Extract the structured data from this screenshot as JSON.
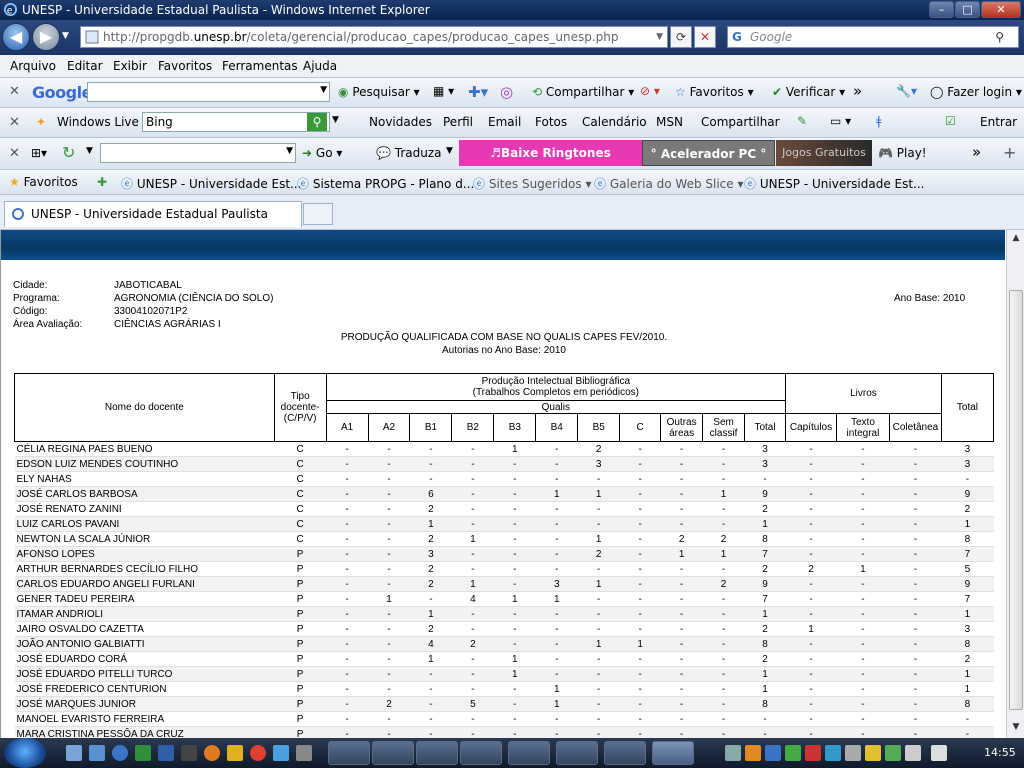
{
  "window": {
    "title": "UNESP - Universidade Estadual Paulista - Windows Internet Explorer"
  },
  "address": {
    "prefix": "http://propgdb.",
    "domain": "unesp.br",
    "suffix": "/coleta/gerencial/producao_capes/producao_capes_unesp.php",
    "search_placeholder": "Google"
  },
  "menu": [
    "Arquivo",
    "Editar",
    "Exibir",
    "Favoritos",
    "Ferramentas",
    "Ajuda"
  ],
  "google_bar": {
    "logo": "Google",
    "pesquisar": "Pesquisar",
    "compartilhar": "Compartilhar",
    "favoritos": "Favoritos",
    "verificar": "Verificar",
    "more": "»",
    "login": "Fazer login"
  },
  "live_bar": {
    "brand": "Windows Live",
    "search_value": "Bing",
    "links": [
      "Novidades",
      "Perfil",
      "Email",
      "Fotos",
      "Calendário",
      "MSN",
      "Compartilhar"
    ],
    "entrar": "Entrar"
  },
  "third_bar": {
    "go": "Go",
    "traduza": "Traduza",
    "ringtones": "♬Baixe Ringtones Celular♬",
    "acelerador": "° Acelerador PC °",
    "jogos": "Jogos Gratuitos",
    "play": "Play!",
    "more": "»"
  },
  "favorites_bar": {
    "favoritos": "Favoritos",
    "items": [
      "UNESP - Universidade Est...",
      "Sistema PROPG - Plano d...",
      "Sites Sugeridos",
      "Galeria do Web Slice",
      "UNESP - Universidade Est..."
    ]
  },
  "tab": {
    "label": "UNESP - Universidade Estadual Paulista"
  },
  "info": {
    "cidade_label": "Cidade:",
    "cidade": "JABOTICABAL",
    "programa_label": "Programa:",
    "programa": "AGRONOMIA (CIÊNCIA DO SOLO)",
    "codigo_label": "Código:",
    "codigo": "33004102071P2",
    "area_label": "Área Avaliação:",
    "area": "CIÊNCIAS AGRÁRIAS I",
    "ano_base": "Ano Base: 2010",
    "heading1": "PRODUÇÃO QUALIFICADA COM BASE NO QUALIS CAPES FEV/2010.",
    "heading2": "Autorias no Ano Base: 2010"
  },
  "table_head": {
    "nome": "Nome do docente",
    "tipo1": "Tipo",
    "tipo2": "docente-",
    "tipo3": "(C/P/V)",
    "prod1": "Produção Intelectual Bibliográfica",
    "prod2": "(Trabalhos Completos em periódicos)",
    "qualis": "Qualis",
    "livros": "Livros",
    "total": "Total",
    "cols": [
      "A1",
      "A2",
      "B1",
      "B2",
      "B3",
      "B4",
      "B5",
      "C",
      "Outras áreas",
      "Sem classif",
      "Total"
    ],
    "livros_cols": [
      "Capítulos",
      "Texto integral",
      "Coletânea"
    ]
  },
  "rows": [
    [
      "CÉLIA REGINA PAES BUENO",
      "C",
      "-",
      "-",
      "-",
      "-",
      "1",
      "-",
      "2",
      "-",
      "-",
      "-",
      "3",
      "-",
      "-",
      "-",
      "3"
    ],
    [
      "EDSON LUIZ MENDES COUTINHO",
      "C",
      "-",
      "-",
      "-",
      "-",
      "-",
      "-",
      "3",
      "-",
      "-",
      "-",
      "3",
      "-",
      "-",
      "-",
      "3"
    ],
    [
      "ELY NAHAS",
      "C",
      "-",
      "-",
      "-",
      "-",
      "-",
      "-",
      "-",
      "-",
      "-",
      "-",
      "-",
      "-",
      "-",
      "-",
      "-"
    ],
    [
      "JOSÉ CARLOS BARBOSA",
      "C",
      "-",
      "-",
      "6",
      "-",
      "-",
      "1",
      "1",
      "-",
      "-",
      "1",
      "9",
      "-",
      "-",
      "-",
      "9"
    ],
    [
      "JOSÉ RENATO ZANINI",
      "C",
      "-",
      "-",
      "2",
      "-",
      "-",
      "-",
      "-",
      "-",
      "-",
      "-",
      "2",
      "-",
      "-",
      "-",
      "2"
    ],
    [
      "LUIZ CARLOS PAVANI",
      "C",
      "-",
      "-",
      "1",
      "-",
      "-",
      "-",
      "-",
      "-",
      "-",
      "-",
      "1",
      "-",
      "-",
      "-",
      "1"
    ],
    [
      "NEWTON LA SCALA JÚNIOR",
      "C",
      "-",
      "-",
      "2",
      "1",
      "-",
      "-",
      "1",
      "-",
      "2",
      "2",
      "8",
      "-",
      "-",
      "-",
      "8"
    ],
    [
      "AFONSO LOPES",
      "P",
      "-",
      "-",
      "3",
      "-",
      "-",
      "-",
      "2",
      "-",
      "1",
      "1",
      "7",
      "-",
      "-",
      "-",
      "7"
    ],
    [
      "ARTHUR BERNARDES CECÍLIO FILHO",
      "P",
      "-",
      "-",
      "2",
      "-",
      "-",
      "-",
      "-",
      "-",
      "-",
      "-",
      "2",
      "2",
      "1",
      "-",
      "5"
    ],
    [
      "CARLOS EDUARDO ANGELI FURLANI",
      "P",
      "-",
      "-",
      "2",
      "1",
      "-",
      "3",
      "1",
      "-",
      "-",
      "2",
      "9",
      "-",
      "-",
      "-",
      "9"
    ],
    [
      "GENER TADEU PEREIRA",
      "P",
      "-",
      "1",
      "-",
      "4",
      "1",
      "1",
      "-",
      "-",
      "-",
      "-",
      "7",
      "-",
      "-",
      "-",
      "7"
    ],
    [
      "ITAMAR ANDRIOLI",
      "P",
      "-",
      "-",
      "1",
      "-",
      "-",
      "-",
      "-",
      "-",
      "-",
      "-",
      "1",
      "-",
      "-",
      "-",
      "1"
    ],
    [
      "JAIRO OSVALDO CAZETTA",
      "P",
      "-",
      "-",
      "2",
      "-",
      "-",
      "-",
      "-",
      "-",
      "-",
      "-",
      "2",
      "1",
      "-",
      "-",
      "3"
    ],
    [
      "JOÃO ANTONIO GALBIATTI",
      "P",
      "-",
      "-",
      "4",
      "2",
      "-",
      "-",
      "1",
      "1",
      "-",
      "-",
      "8",
      "-",
      "-",
      "-",
      "8"
    ],
    [
      "JOSÉ EDUARDO CORÁ",
      "P",
      "-",
      "-",
      "1",
      "-",
      "1",
      "-",
      "-",
      "-",
      "-",
      "-",
      "2",
      "-",
      "-",
      "-",
      "2"
    ],
    [
      "JOSÉ EDUARDO PITELLI TURCO",
      "P",
      "-",
      "-",
      "-",
      "-",
      "1",
      "-",
      "-",
      "-",
      "-",
      "-",
      "1",
      "-",
      "-",
      "-",
      "1"
    ],
    [
      "JOSÉ FREDERICO CENTURION",
      "P",
      "-",
      "-",
      "-",
      "-",
      "-",
      "1",
      "-",
      "-",
      "-",
      "-",
      "1",
      "-",
      "-",
      "-",
      "1"
    ],
    [
      "JOSÉ MARQUES JUNIOR",
      "P",
      "-",
      "2",
      "-",
      "5",
      "-",
      "1",
      "-",
      "-",
      "-",
      "-",
      "8",
      "-",
      "-",
      "-",
      "8"
    ],
    [
      "MANOEL EVARISTO FERREIRA",
      "P",
      "-",
      "-",
      "-",
      "-",
      "-",
      "-",
      "-",
      "-",
      "-",
      "-",
      "-",
      "-",
      "-",
      "-",
      "-"
    ],
    [
      "MARA CRISTINA PESSÔA DA CRUZ",
      "P",
      "-",
      "-",
      "-",
      "-",
      "-",
      "-",
      "-",
      "-",
      "-",
      "-",
      "-",
      "-",
      "-",
      "-",
      "-"
    ]
  ],
  "taskbar": {
    "clock": "14:55"
  },
  "colors": {
    "title_bar": "#0a2350",
    "page_band": "#083863",
    "pink_button": "#e63ab5"
  }
}
